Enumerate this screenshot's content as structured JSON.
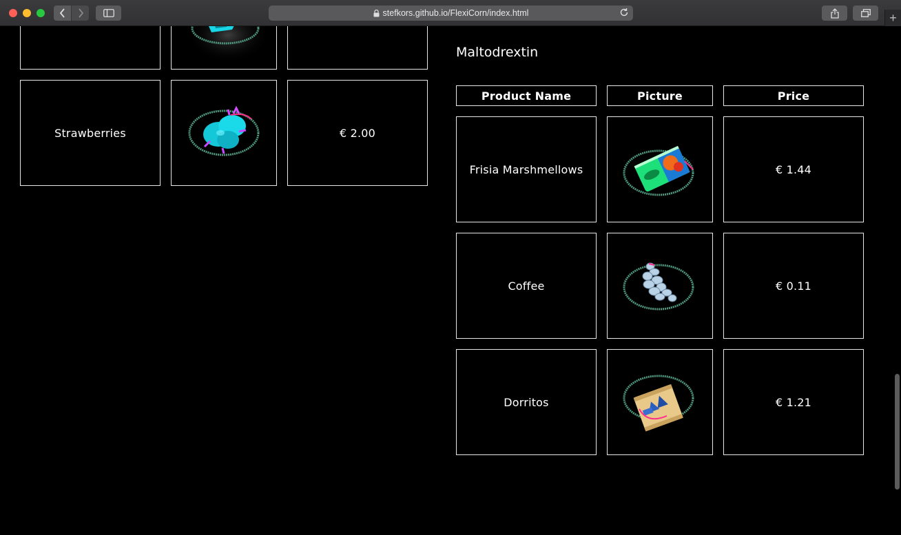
{
  "browser": {
    "url": "stefkors.github.io/FlexiCorn/index.html",
    "icons": [
      "back-icon",
      "forward-icon",
      "sidebar-icon",
      "lock-icon",
      "reload-icon",
      "share-icon",
      "tabs-icon",
      "plus-icon"
    ]
  },
  "left_table": {
    "rows": [
      {
        "name": "",
        "price": "",
        "picture": "cyan-product-partial"
      },
      {
        "name": "Strawberries",
        "price": "€ 2.00",
        "picture": "strawberries"
      }
    ]
  },
  "right_section": {
    "title": "Maltodrextin",
    "headers": {
      "name": "Product Name",
      "picture": "Picture",
      "price": "Price"
    },
    "rows": [
      {
        "name": "Frisia Marshmellows",
        "price": "€ 1.44",
        "picture": "marshmellows-bag"
      },
      {
        "name": "Coffee",
        "price": "€ 0.11",
        "picture": "coffee"
      },
      {
        "name": "Dorritos",
        "price": "€ 1.21",
        "picture": "dorritos-bag"
      }
    ]
  },
  "colors": {
    "background": "#000000",
    "border": "#e8e8e8",
    "ellipse": "#4f9a7e",
    "accent": "#ff2d8a"
  }
}
